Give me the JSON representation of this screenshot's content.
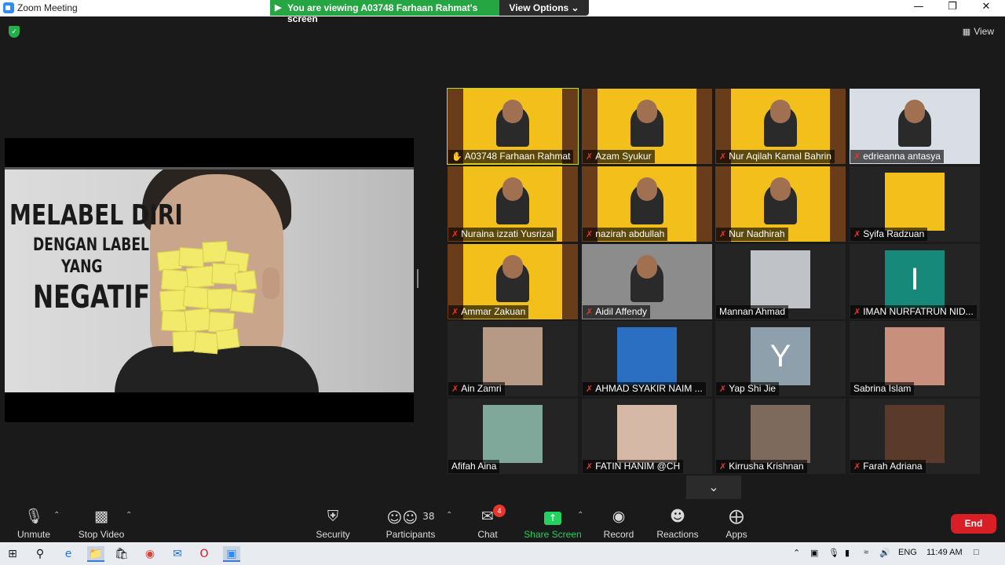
{
  "window": {
    "title": "Zoom Meeting",
    "minimize": "—",
    "maximize": "❐",
    "close": "✕"
  },
  "banner": {
    "text": "You are viewing A03748 Farhaan Rahmat's screen",
    "view_options": "View Options ⌄"
  },
  "top_right": {
    "view_label": "View"
  },
  "slide": {
    "line1": "MELABEL DIRI",
    "line2": "DENGAN LABEL",
    "line3": "YANG",
    "line4": "NEGATIF"
  },
  "participants_grid": [
    {
      "name": "A03748 Farhaan Rahmat",
      "video": "poster",
      "muted": false,
      "active": true
    },
    {
      "name": "Azam Syukur",
      "video": "poster",
      "muted": true
    },
    {
      "name": "Nur Aqilah Kamal Bahrin",
      "video": "poster",
      "muted": true
    },
    {
      "name": "edrieanna antasya",
      "video": "photo",
      "muted": true,
      "color": "#d9dde6"
    },
    {
      "name": "Nuraina izzati Yusrizal",
      "video": "poster",
      "muted": true
    },
    {
      "name": "nazirah abdullah",
      "video": "poster",
      "muted": true
    },
    {
      "name": "Nur Nadhirah",
      "video": "poster",
      "muted": true
    },
    {
      "name": "Syifa Radzuan",
      "video": "pic",
      "muted": true,
      "color": "#f3c01b"
    },
    {
      "name": "Ammar Zakuan",
      "video": "poster",
      "muted": true
    },
    {
      "name": "Aidil Affendy",
      "video": "photo",
      "muted": true,
      "color": "#8c8c8c"
    },
    {
      "name": "Mannan Ahmad",
      "video": "pic",
      "muted": false,
      "color": "#bfc3c8"
    },
    {
      "name": "IMAN NURFATRUN NID...",
      "video": "initial",
      "initial": "I",
      "muted": true,
      "color": "#17897a"
    },
    {
      "name": "Ain Zamri",
      "video": "pic",
      "muted": true,
      "color": "#b79a86"
    },
    {
      "name": "AHMAD SYAKIR NAIM ...",
      "video": "pic",
      "muted": true,
      "color": "#2a6fc2"
    },
    {
      "name": "Yap Shi Jie",
      "video": "initial",
      "initial": "Y",
      "muted": true,
      "color": "#8ea0ac"
    },
    {
      "name": "Sabrina Islam",
      "video": "pic",
      "muted": false,
      "color": "#c98f7d"
    },
    {
      "name": "Afifah Aina",
      "video": "pic",
      "muted": false,
      "color": "#7fa89a"
    },
    {
      "name": "FATIN HANIM @CH",
      "video": "pic",
      "muted": true,
      "color": "#d6b8a6"
    },
    {
      "name": "Kirrusha Krishnan",
      "video": "pic",
      "muted": true,
      "color": "#7d6a5c"
    },
    {
      "name": "Farah Adriana",
      "video": "pic",
      "muted": true,
      "color": "#5a3a2a"
    }
  ],
  "toolbar": {
    "unmute": "Unmute",
    "stop_video": "Stop Video",
    "security": "Security",
    "participants": "Participants",
    "participants_count": "38",
    "chat": "Chat",
    "chat_badge": "4",
    "share_screen": "Share Screen",
    "record": "Record",
    "reactions": "Reactions",
    "apps": "Apps",
    "end": "End"
  },
  "taskbar": {
    "language": "ENG",
    "time": "11:49 AM"
  },
  "colors": {
    "banner_green": "#26a643",
    "end_red": "#d81f26",
    "active_speaker": "#b8d832",
    "share_green": "#23d160"
  }
}
